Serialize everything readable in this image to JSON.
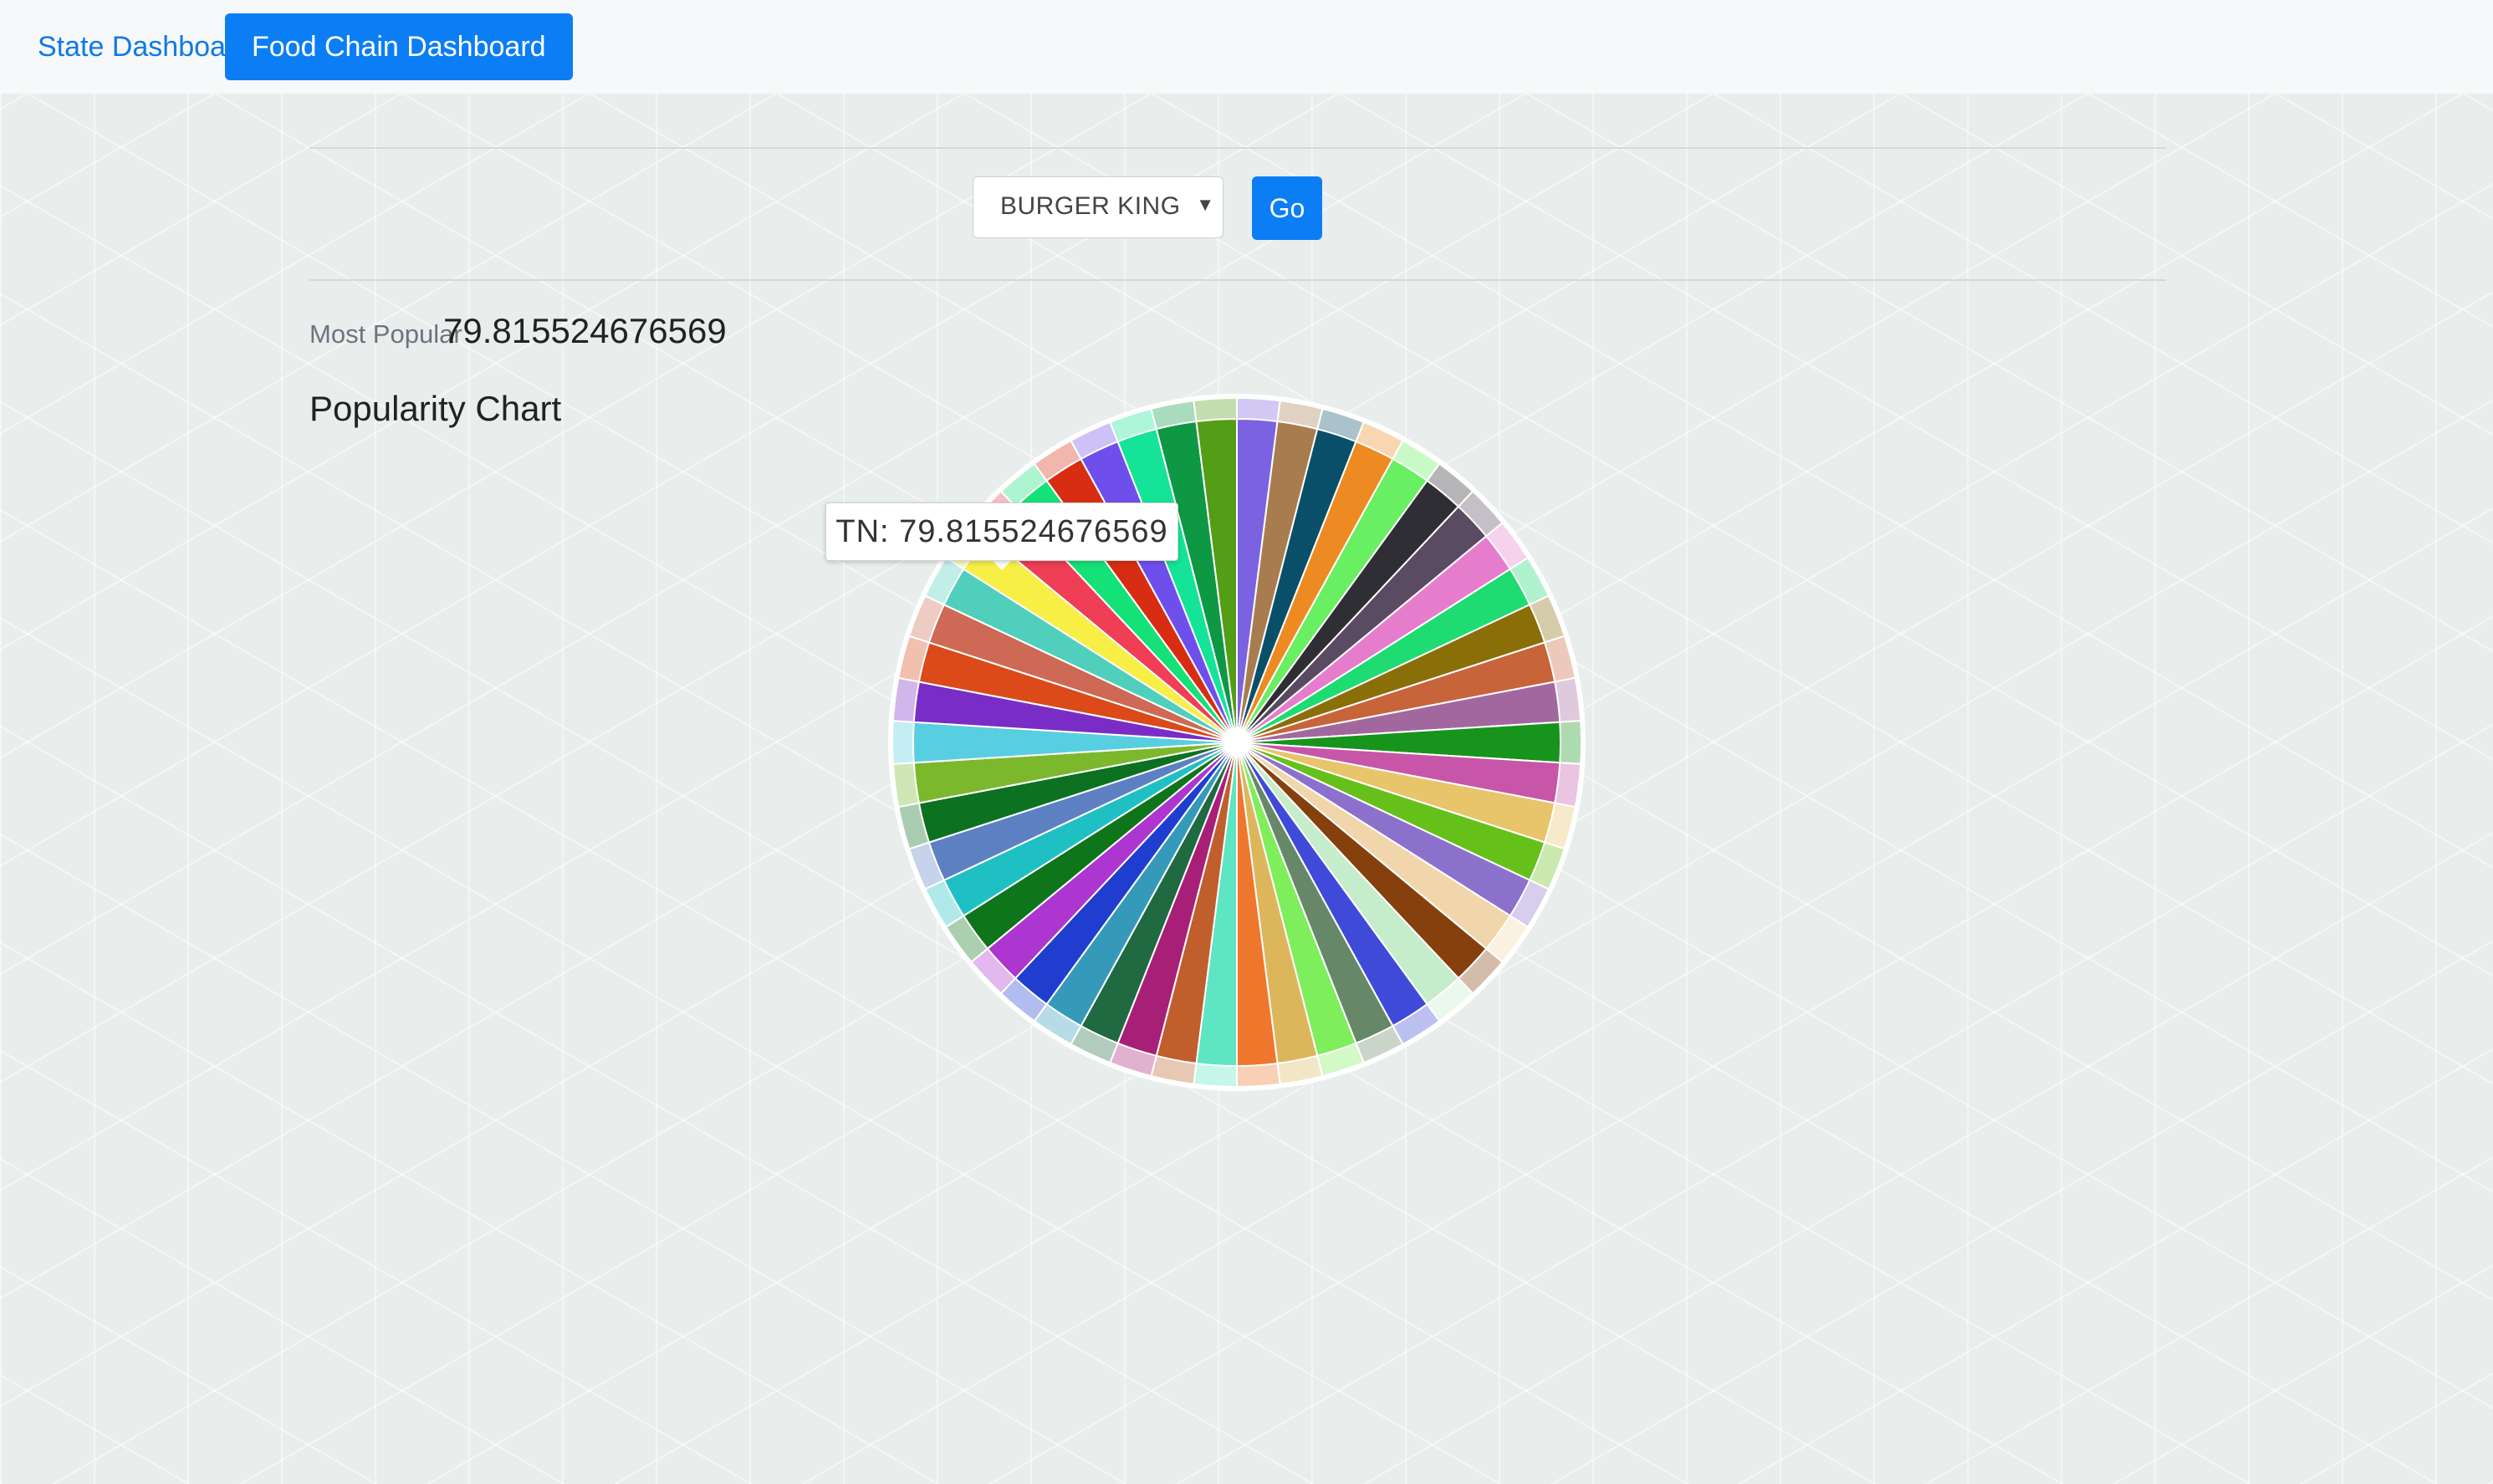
{
  "nav": {
    "items": [
      {
        "label": "State Dashboard",
        "active": false
      },
      {
        "label": "Food Chain Dashboard",
        "active": true
      }
    ]
  },
  "controls": {
    "select_value": "BURGER KING",
    "go_label": "Go"
  },
  "summary": {
    "most_popular_label": "Most Popular",
    "most_popular_value": "79.815524676569"
  },
  "chart_title": "Popularity Chart",
  "tooltip": {
    "text": "TN: 79.815524676569"
  },
  "colors": {
    "primary": "#0c7ef5",
    "link": "#0f7ae5"
  },
  "chart_data": {
    "type": "pie",
    "title": "Popularity Chart",
    "grid": false,
    "legend": "none",
    "hovered_slice": {
      "label": "TN",
      "value": 79.815524676569
    },
    "slices": [
      {
        "value": 1,
        "color": "#7b62e0"
      },
      {
        "value": 1,
        "color": "#a97c50"
      },
      {
        "value": 1,
        "color": "#0a4f6a"
      },
      {
        "value": 1,
        "color": "#ee8a22"
      },
      {
        "value": 1,
        "color": "#68ef62"
      },
      {
        "value": 1,
        "color": "#2e2e34"
      },
      {
        "value": 1,
        "color": "#5a4a62"
      },
      {
        "value": 1,
        "color": "#e57dcc"
      },
      {
        "value": 1,
        "color": "#1edb72"
      },
      {
        "value": 1,
        "color": "#8a6e08"
      },
      {
        "value": 1,
        "color": "#c8643a"
      },
      {
        "value": 1,
        "color": "#a2689e"
      },
      {
        "value": 1,
        "color": "#17941b"
      },
      {
        "value": 1,
        "color": "#c756a8"
      },
      {
        "value": 1,
        "color": "#e8c46a"
      },
      {
        "value": 1,
        "color": "#66c01a"
      },
      {
        "value": 1,
        "color": "#8c71cc"
      },
      {
        "value": 1,
        "color": "#f0d6aa"
      },
      {
        "value": 1,
        "color": "#85400e"
      },
      {
        "value": 1,
        "color": "#c5eccb"
      },
      {
        "value": 1,
        "color": "#3f4bd8"
      },
      {
        "value": 1,
        "color": "#678868"
      },
      {
        "value": 1,
        "color": "#7eee5c"
      },
      {
        "value": 1,
        "color": "#ddb65c"
      },
      {
        "value": 1,
        "color": "#ef762d"
      },
      {
        "value": 1,
        "color": "#5de5c4"
      },
      {
        "value": 1,
        "color": "#c05e2c"
      },
      {
        "value": 1,
        "color": "#a81f78"
      },
      {
        "value": 1,
        "color": "#1f6a40"
      },
      {
        "value": 1,
        "color": "#359aba"
      },
      {
        "value": 1,
        "color": "#1f3ed0"
      },
      {
        "value": 1,
        "color": "#ad35d0"
      },
      {
        "value": 1,
        "color": "#0e751b"
      },
      {
        "value": 1,
        "color": "#1fc0c4"
      },
      {
        "value": 1,
        "color": "#5d80c2"
      },
      {
        "value": 1,
        "color": "#0c7120"
      },
      {
        "value": 1,
        "color": "#7cb82c"
      },
      {
        "value": 1,
        "color": "#58cfe0"
      },
      {
        "value": 1,
        "color": "#7a2dc6"
      },
      {
        "value": 1,
        "color": "#db4a18"
      },
      {
        "value": 1,
        "color": "#cd6954"
      },
      {
        "value": 1,
        "color": "#4fcfbc",
        "label": "TN",
        "value_label": 79.815524676569
      },
      {
        "value": 1,
        "color": "#f7ef45"
      },
      {
        "value": 1,
        "color": "#ef3e55"
      },
      {
        "value": 1,
        "color": "#14e178"
      },
      {
        "value": 1,
        "color": "#d82d12"
      },
      {
        "value": 1,
        "color": "#6e4fec"
      },
      {
        "value": 1,
        "color": "#14e398"
      },
      {
        "value": 1,
        "color": "#0e9844"
      },
      {
        "value": 1,
        "color": "#549d17"
      }
    ]
  }
}
